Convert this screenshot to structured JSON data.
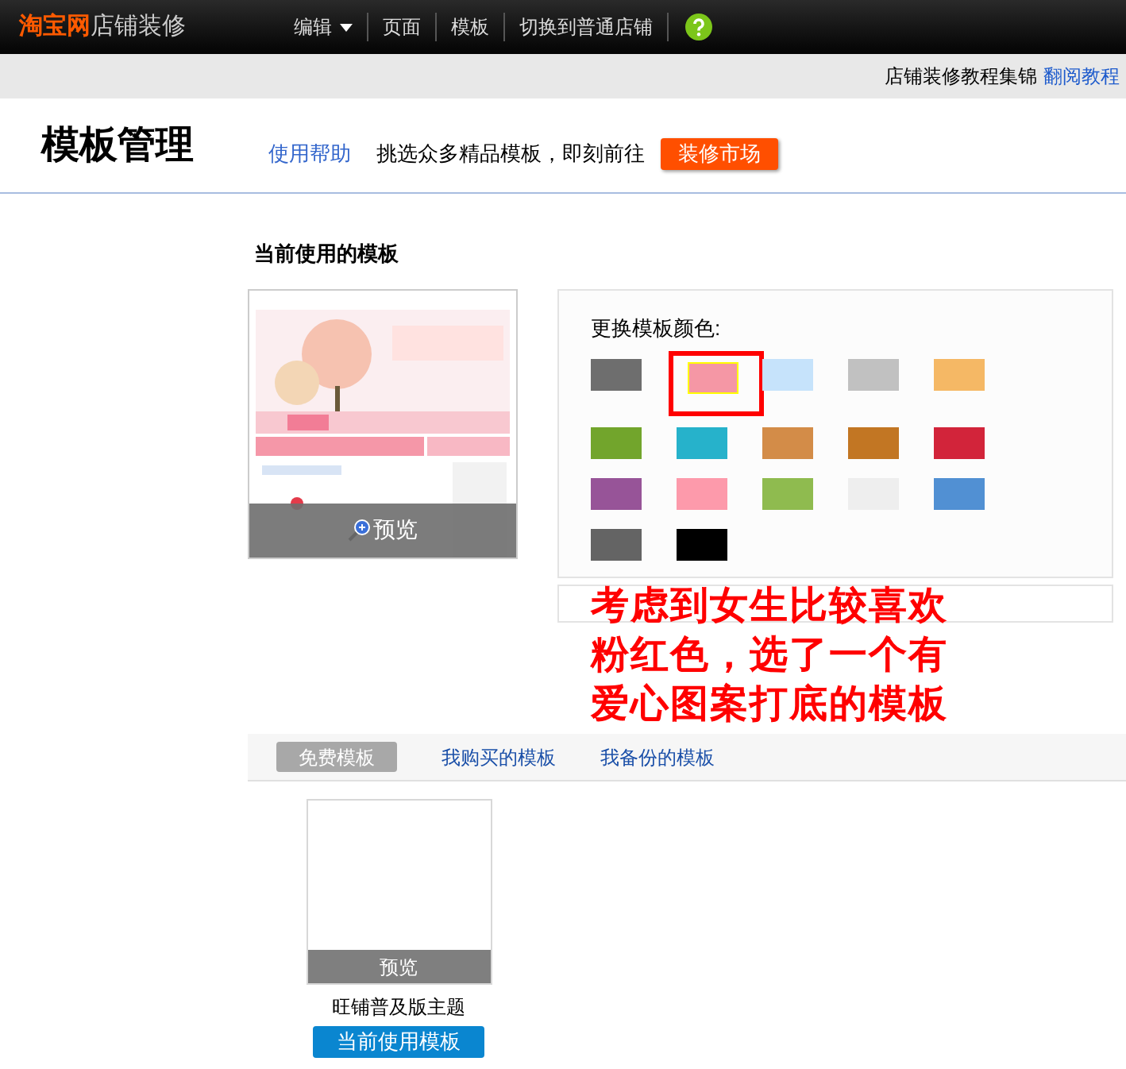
{
  "topbar": {
    "logo_brand": "淘宝网",
    "logo_suffix": "店铺装修",
    "menu": [
      {
        "label": "编辑",
        "dropdown": true
      },
      {
        "label": "页面",
        "dropdown": false
      },
      {
        "label": "模板",
        "dropdown": false
      },
      {
        "label": "切换到普通店铺",
        "dropdown": false
      }
    ]
  },
  "subbar": {
    "text": "店铺装修教程集锦",
    "link": "翻阅教程"
  },
  "header": {
    "title": "模板管理",
    "help": "使用帮助",
    "promo": "挑选众多精品模板，即刻前往",
    "market_button": "装修市场"
  },
  "current": {
    "heading": "当前使用的模板",
    "preview": "预览",
    "palette_label": "更换模板颜色:",
    "swatches": [
      {
        "color": "#6e6e6e",
        "selected": false
      },
      {
        "color": "#f597a5",
        "selected": true
      },
      {
        "color": "#c6e3fb",
        "selected": false
      },
      {
        "color": "#c1c1c1",
        "selected": false
      },
      {
        "color": "#f5b865",
        "selected": false
      },
      {
        "color": "#72a52c",
        "selected": false
      },
      {
        "color": "#26b2cb",
        "selected": false
      },
      {
        "color": "#d38c48",
        "selected": false
      },
      {
        "color": "#c27623",
        "selected": false
      },
      {
        "color": "#d2243a",
        "selected": false
      },
      {
        "color": "#975498",
        "selected": false
      },
      {
        "color": "#fd9aab",
        "selected": false
      },
      {
        "color": "#8fbb4f",
        "selected": false
      },
      {
        "color": "#eeeeee",
        "selected": false
      },
      {
        "color": "#5190d3",
        "selected": false
      },
      {
        "color": "#646464",
        "selected": false
      },
      {
        "color": "#000000",
        "selected": false
      }
    ]
  },
  "annotation": "考虑到女生比较喜欢粉红色，选了一个有爱心图案打底的模板",
  "tabs": [
    {
      "label": "免费模板",
      "selected": true
    },
    {
      "label": "我购买的模板",
      "selected": false
    },
    {
      "label": "我备份的模板",
      "selected": false
    }
  ],
  "templates": [
    {
      "preview": "预览",
      "name": "旺铺普及版主题",
      "action": "当前使用模板"
    }
  ]
}
